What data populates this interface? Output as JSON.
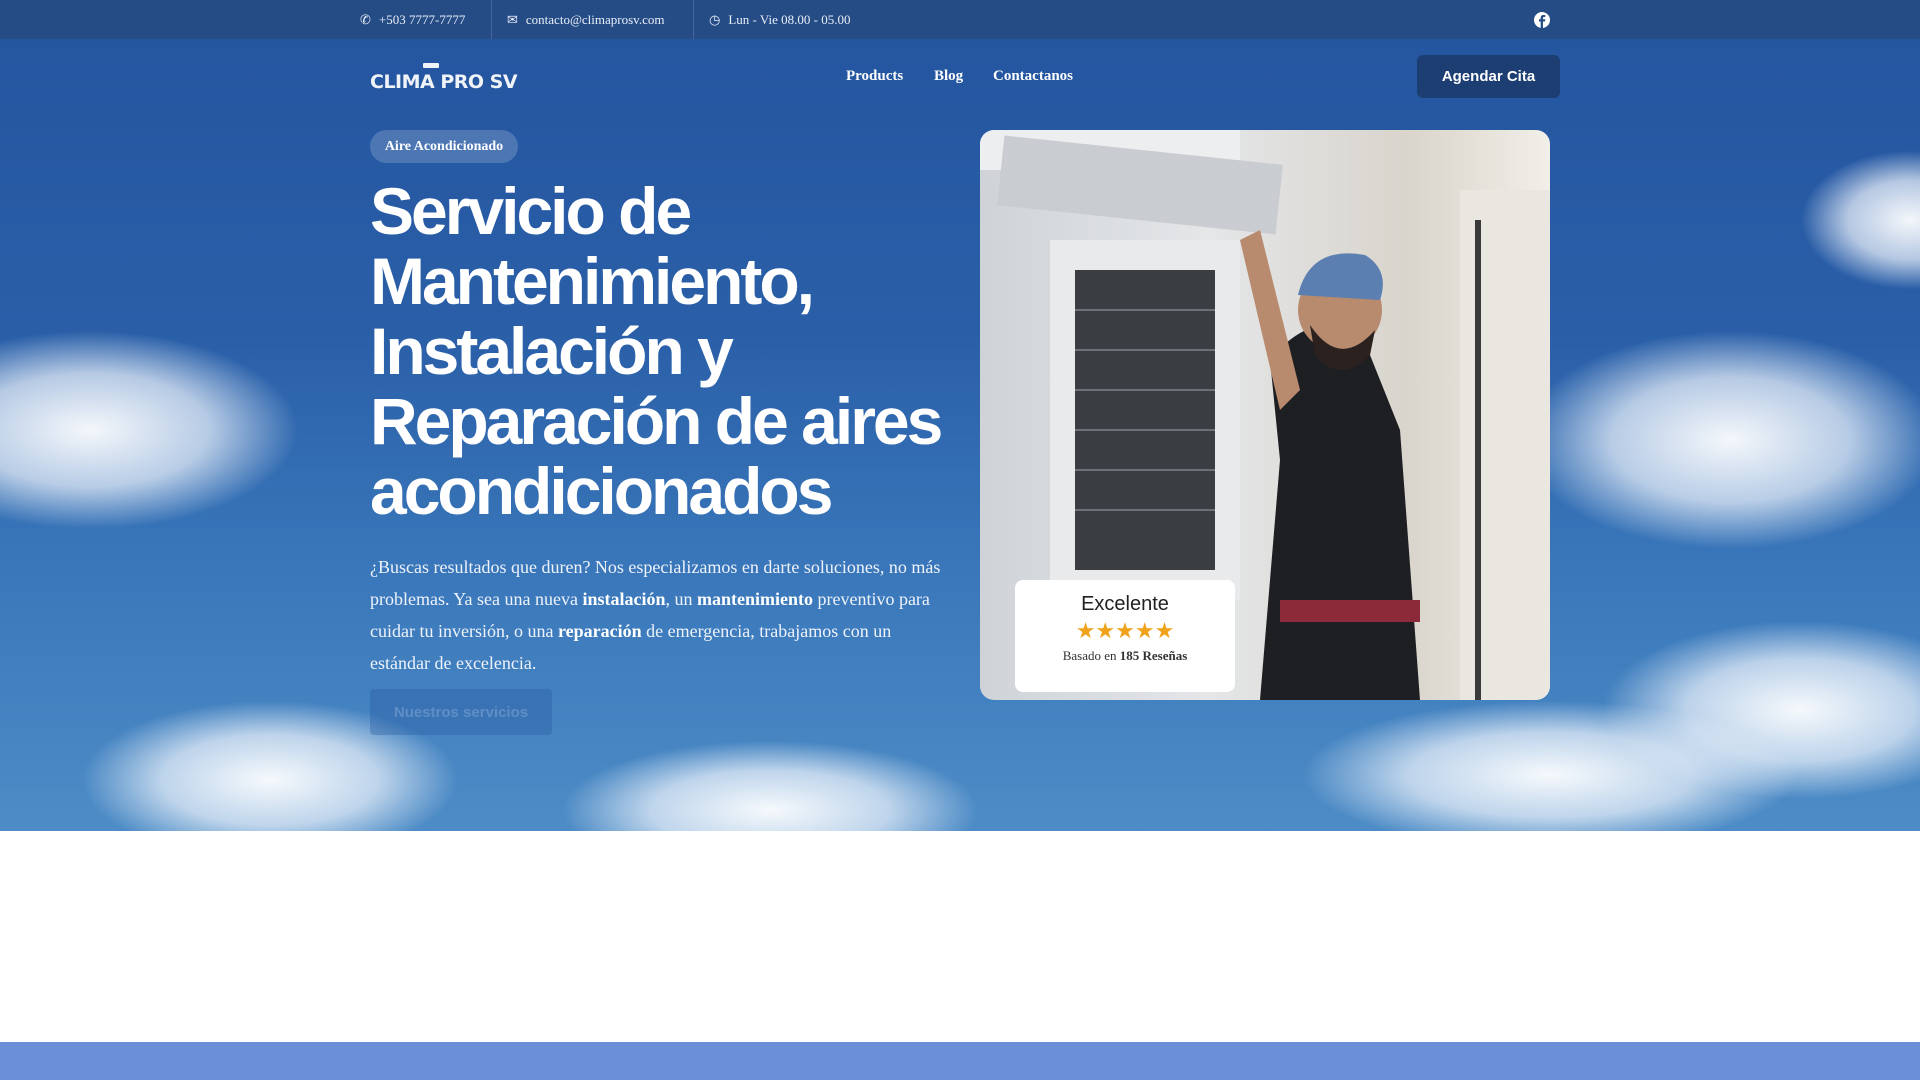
{
  "topbar": {
    "phone": "+503 7777-7777",
    "email": "contacto@climaprosv.com",
    "hours": "Lun - Vie 08.00 - 05.00"
  },
  "header": {
    "logo": "CLIMA PRO SV",
    "nav": [
      "Products",
      "Blog",
      "Contactanos"
    ],
    "cta": "Agendar Cita"
  },
  "hero": {
    "badge": "Aire Acondicionado",
    "title": "Servicio de Mantenimiento, Instalación y Reparación de aires acondicionados",
    "para": {
      "p1": "¿Buscas resultados que duren? Nos especializamos en darte soluciones, no más problemas. Ya sea una nueva ",
      "b1": "instalación",
      "p2": ", un ",
      "b2": "mantenimiento",
      "p3": " preventivo para cuidar tu inversión, o una ",
      "b3": "reparación",
      "p4": " de emergencia, trabajamos con un estándar de excelencia."
    },
    "button": "Nuestros servicios"
  },
  "rating": {
    "title": "Excelente",
    "stars": 5,
    "prefix": "Basado en ",
    "count": "185 Reseñas"
  },
  "colors": {
    "topbar": "#264c86",
    "cta": "#1d3e72",
    "star": "#f0a21b",
    "strip": "#6a8fd6"
  }
}
